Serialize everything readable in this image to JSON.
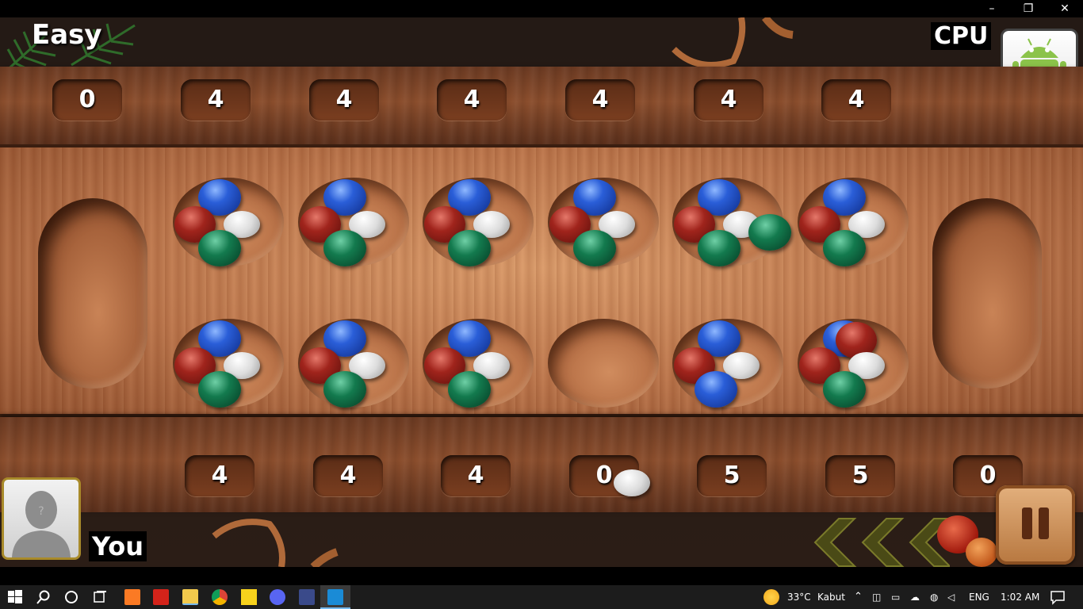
{
  "window": {
    "minimize_icon": "minimize-icon",
    "restore_icon": "restore-icon",
    "close_icon": "close-icon",
    "minimize_glyph": "–",
    "restore_glyph": "❐",
    "close_glyph": "✕"
  },
  "game": {
    "difficulty": "Easy",
    "opponent_label": "CPU",
    "player_label": "You",
    "opponent_store": "0",
    "opponent_pits": [
      "4",
      "4",
      "4",
      "4",
      "4",
      "4"
    ],
    "player_pits": [
      "4",
      "4",
      "4",
      "0",
      "5",
      "5"
    ],
    "player_store": "0",
    "pause_icon": "pause-icon",
    "opponent_avatar_icon": "android-icon",
    "player_avatar_icon": "user-silhouette-icon",
    "avatar_question": "?"
  },
  "taskbar": {
    "weather_temp": "33°C",
    "weather_desc": "Kabut",
    "language": "ENG",
    "time": "1:02 AM",
    "apps": [
      "start-icon",
      "search-icon",
      "cortana-icon",
      "task-view-icon",
      "xampp-icon",
      "acrobat-icon",
      "file-explorer-icon",
      "chrome-icon",
      "sticky-notes-icon",
      "discord-icon",
      "app-icon",
      "media-player-icon"
    ],
    "colors": {
      "xampp": "#fb7a24",
      "acrobat": "#d4231a",
      "explorer": "#f2c94c",
      "chrome_r": "#db4437",
      "sticky": "#f7d21c",
      "discord": "#5865f2",
      "media": "#1a8bd6"
    }
  }
}
